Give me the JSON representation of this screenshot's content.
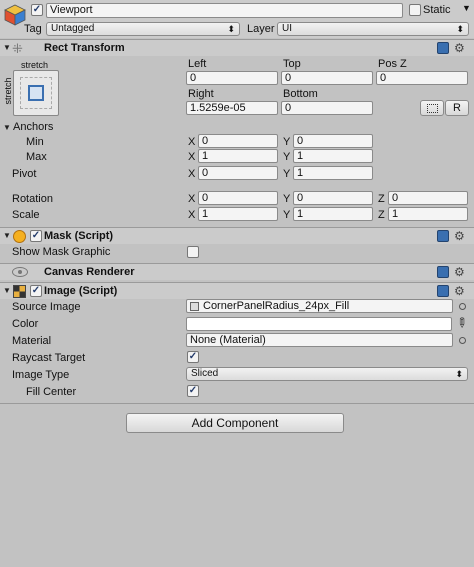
{
  "gameobject": {
    "name": "Viewport",
    "static_label": "Static",
    "tag_label": "Tag",
    "tag_value": "Untagged",
    "layer_label": "Layer",
    "layer_value": "UI"
  },
  "rect_transform": {
    "title": "Rect Transform",
    "anchor_preset_top": "stretch",
    "anchor_preset_side": "stretch",
    "col_left": "Left",
    "col_top": "Top",
    "col_posz": "Pos Z",
    "left": "0",
    "top": "0",
    "posz": "0",
    "col_right": "Right",
    "col_bottom": "Bottom",
    "right": "1.5259e-05",
    "bottom": "0",
    "raw_button": "R",
    "anchors_label": "Anchors",
    "min_label": "Min",
    "max_label": "Max",
    "pivot_label": "Pivot",
    "min_x": "0",
    "min_y": "0",
    "max_x": "1",
    "max_y": "1",
    "pivot_x": "0",
    "pivot_y": "1",
    "rotation_label": "Rotation",
    "scale_label": "Scale",
    "rot_x": "0",
    "rot_y": "0",
    "rot_z": "0",
    "scale_x": "1",
    "scale_y": "1",
    "scale_z": "1",
    "x": "X",
    "y": "Y",
    "z": "Z"
  },
  "mask": {
    "title": "Mask (Script)",
    "show_graphic_label": "Show Mask Graphic"
  },
  "canvas_renderer": {
    "title": "Canvas Renderer"
  },
  "image": {
    "title": "Image (Script)",
    "source_image_label": "Source Image",
    "source_image_value": "CornerPanelRadius_24px_Fill",
    "color_label": "Color",
    "material_label": "Material",
    "material_value": "None (Material)",
    "raycast_label": "Raycast Target",
    "image_type_label": "Image Type",
    "image_type_value": "Sliced",
    "fill_center_label": "Fill Center"
  },
  "add_component_label": "Add Component",
  "colors": {
    "background": "#c2c2c2",
    "header": "#cbcbcb",
    "field": "#f4f4f4",
    "accent": "#3a6fb0"
  }
}
